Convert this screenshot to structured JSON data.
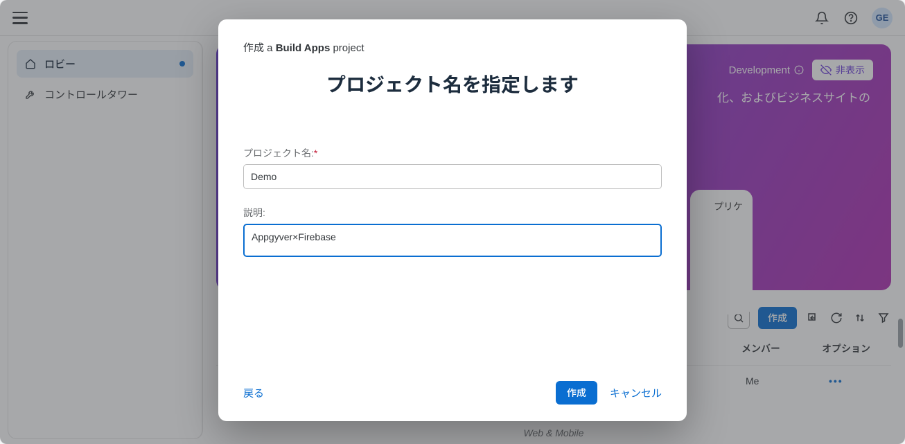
{
  "topbar": {
    "avatar_initials": "GE"
  },
  "sidebar": {
    "items": [
      {
        "label": "ロビー",
        "icon": "home-icon",
        "active": true
      },
      {
        "label": "コントロールタワー",
        "icon": "wrench-icon",
        "active": false
      }
    ]
  },
  "hero": {
    "dev_label": "Development",
    "hide_label": "非表示",
    "subtitle_fragment": "化、およびビジネスサイトの",
    "card_text_fragment": "プリケ"
  },
  "toolbar": {
    "create_label": "作成"
  },
  "table": {
    "headers": {
      "members": "メンバー",
      "options": "オプション"
    },
    "row": {
      "members": "Me",
      "options": "•••"
    }
  },
  "footer_wm": "Web & Mobile",
  "modal": {
    "pretitle_prefix": "作成 a ",
    "pretitle_strong": "Build Apps",
    "pretitle_suffix": " project",
    "title": "プロジェクト名を指定します",
    "project_name_label": "プロジェクト名:",
    "project_name_value": "Demo",
    "description_label": "説明:",
    "description_value": "Appgyver×Firebase",
    "back_label": "戻る",
    "create_label": "作成",
    "cancel_label": "キャンセル"
  }
}
